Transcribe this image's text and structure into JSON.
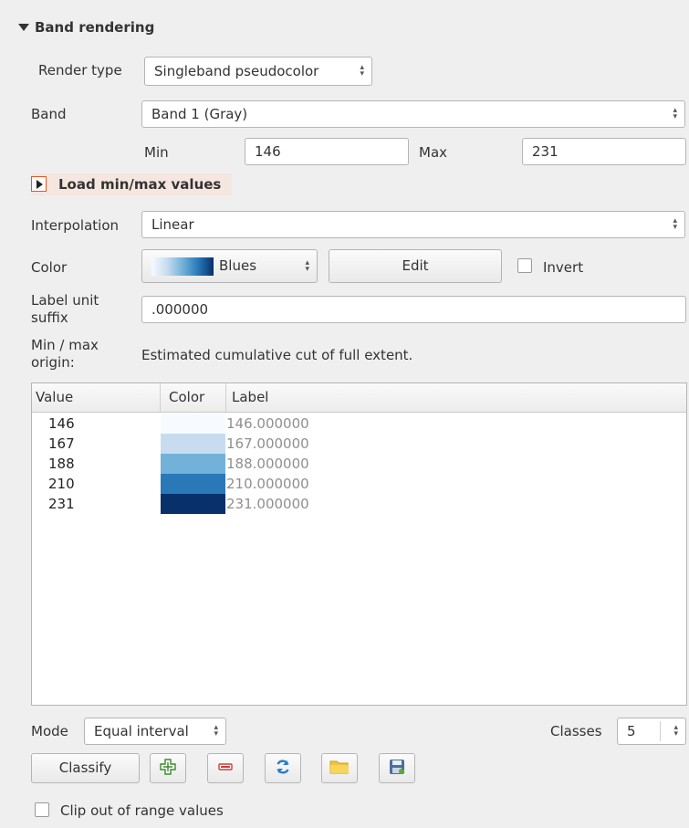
{
  "section": {
    "title": "Band rendering"
  },
  "render_type": {
    "label": "Render type",
    "value": "Singleband pseudocolor"
  },
  "band": {
    "label": "Band",
    "value": "Band 1 (Gray)"
  },
  "minmax": {
    "min_label": "Min",
    "min_value": "146",
    "max_label": "Max",
    "max_value": "231"
  },
  "load_minmax": {
    "label": "Load min/max values"
  },
  "interpolation": {
    "label": "Interpolation",
    "value": "Linear"
  },
  "color": {
    "label": "Color",
    "ramp_name": "Blues",
    "edit_label": "Edit",
    "invert_label": "Invert",
    "invert_checked": false
  },
  "label_unit_suffix": {
    "label_line1": "Label unit",
    "label_line2": "suffix",
    "value": ".000000"
  },
  "minmax_origin": {
    "label_line1": "Min / max",
    "label_line2": "origin:",
    "value": "Estimated cumulative cut of full extent."
  },
  "table": {
    "headers": [
      "Value",
      "Color",
      "Label"
    ],
    "rows": [
      {
        "value": "146",
        "color": "#f7fbff",
        "label": "146.000000"
      },
      {
        "value": "167",
        "color": "#c8dcf0",
        "label": "167.000000"
      },
      {
        "value": "188",
        "color": "#73b2d8",
        "label": "188.000000"
      },
      {
        "value": "210",
        "color": "#2979b9",
        "label": "210.000000"
      },
      {
        "value": "231",
        "color": "#08306b",
        "label": "231.000000"
      }
    ]
  },
  "mode": {
    "label": "Mode",
    "value": "Equal interval",
    "classes_label": "Classes",
    "classes_value": "5"
  },
  "actions": {
    "classify_label": "Classify",
    "icons": [
      "add-class-icon",
      "remove-class-icon",
      "refresh-icon",
      "load-file-icon",
      "save-file-icon"
    ]
  },
  "clip": {
    "label": "Clip out of range values",
    "checked": false
  },
  "colors": {
    "accent": "#e95420",
    "ramp_start": "#f7fbff",
    "ramp_end": "#08306b"
  }
}
